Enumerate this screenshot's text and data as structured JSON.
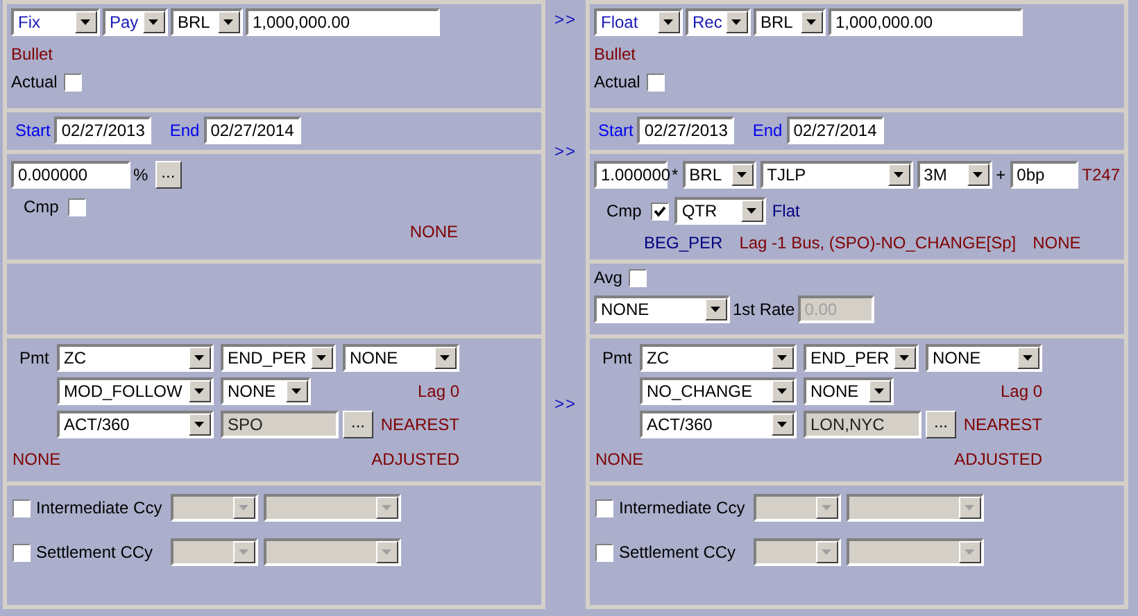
{
  "legs": [
    {
      "header": {
        "type": {
          "value": "Fix"
        },
        "direction": {
          "value": "Pay"
        },
        "currency": {
          "value": "BRL"
        },
        "notional": "1,000,000.00"
      },
      "amortization": "Bullet",
      "actual": {
        "label": "Actual",
        "checked": false
      },
      "dates": {
        "start_label": "Start",
        "start": "02/27/2013",
        "end_label": "End",
        "end": "02/27/2014"
      },
      "rate": {
        "kind": "fixed",
        "rate": "0.000000",
        "unit": "%",
        "button": "...",
        "compounding": {
          "label": "Cmp",
          "checked": false
        },
        "status": "NONE"
      },
      "payment": {
        "label": "Pmt",
        "frequency": {
          "value": "ZC"
        },
        "timing": {
          "value": "END_PER"
        },
        "roll": {
          "value": "NONE"
        },
        "convention": {
          "value": "MOD_FOLLOW"
        },
        "adjust": {
          "value": "NONE"
        },
        "lag": "Lag 0",
        "day_count": {
          "value": "ACT/360"
        },
        "calendar": {
          "value": "SPO",
          "disabled": true
        },
        "calendar_button": "...",
        "rounding": "NEAREST",
        "stub": "NONE",
        "accrual": "ADJUSTED"
      },
      "currencies": [
        {
          "label": "Intermediate Ccy",
          "checked": false,
          "currency": {
            "disabled": true
          },
          "rate": {
            "disabled": true
          }
        },
        {
          "label": "Settlement CCy",
          "checked": false,
          "currency": {
            "disabled": true
          },
          "rate": {
            "disabled": true
          }
        }
      ]
    },
    {
      "header": {
        "type": {
          "value": "Float"
        },
        "direction": {
          "value": "Rec"
        },
        "currency": {
          "value": "BRL"
        },
        "notional": "1,000,000.00",
        "copy_button": ">>"
      },
      "amortization": "Bullet",
      "actual": {
        "label": "Actual",
        "checked": false
      },
      "dates": {
        "start_label": "Start",
        "start": "02/27/2013",
        "end_label": "End",
        "end": "02/27/2014",
        "copy_button": ">>"
      },
      "rate": {
        "kind": "float",
        "multiplier": "1.000000",
        "times": "*",
        "currency": {
          "value": "BRL"
        },
        "index": {
          "value": "TJLP"
        },
        "tenor": {
          "value": "3M"
        },
        "plus": "+",
        "spread": "0bp",
        "code": "T247",
        "compounding": {
          "label": "Cmp",
          "checked": true
        },
        "frequency": {
          "value": "QTR"
        },
        "method": "Flat",
        "reset": "BEG_PER",
        "fixing": "Lag -1 Bus, (SPO)-NO_CHANGE[Sp]",
        "status": "NONE"
      },
      "averaging": {
        "label": "Avg",
        "checked": false,
        "method": {
          "value": "NONE"
        },
        "first_rate_label": "1st Rate",
        "first_rate": {
          "value": "0.00",
          "disabled": true
        }
      },
      "payment": {
        "copy_button": ">>",
        "label": "Pmt",
        "frequency": {
          "value": "ZC"
        },
        "timing": {
          "value": "END_PER"
        },
        "roll": {
          "value": "NONE"
        },
        "convention": {
          "value": "NO_CHANGE"
        },
        "adjust": {
          "value": "NONE"
        },
        "lag": "Lag 0",
        "day_count": {
          "value": "ACT/360"
        },
        "calendar": {
          "value": "LON,NYC",
          "disabled": true
        },
        "calendar_button": "...",
        "rounding": "NEAREST",
        "stub": "NONE",
        "accrual": "ADJUSTED"
      },
      "currencies": [
        {
          "label": "Intermediate Ccy",
          "checked": false,
          "currency": {
            "disabled": true
          },
          "rate": {
            "disabled": true
          }
        },
        {
          "label": "Settlement CCy",
          "checked": false,
          "currency": {
            "disabled": true
          },
          "rate": {
            "disabled": true
          }
        }
      ]
    }
  ]
}
